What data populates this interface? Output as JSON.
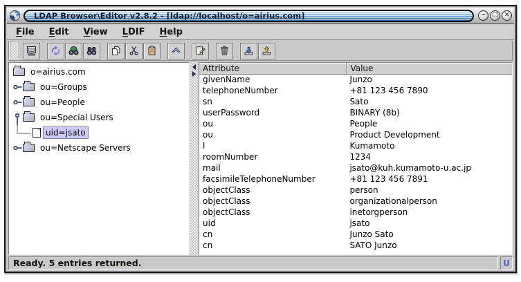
{
  "window": {
    "title": "LDAP Browser\\Editor v2.8.2 - [ldap://localhost/o=airius.com]",
    "app_icon": "globe-swirl-icon",
    "controls": [
      {
        "name": "minimize",
        "glyph": "−"
      },
      {
        "name": "maximize",
        "glyph": "□"
      },
      {
        "name": "close",
        "glyph": "✕"
      }
    ]
  },
  "menu_bar": {
    "items": [
      {
        "label": "File",
        "mnemonic": "F"
      },
      {
        "label": "Edit",
        "mnemonic": "E"
      },
      {
        "label": "View",
        "mnemonic": "V"
      },
      {
        "label": "LDIF",
        "mnemonic": "L"
      },
      {
        "label": "Help",
        "mnemonic": "H"
      }
    ]
  },
  "toolbar": {
    "buttons": [
      {
        "name": "connect",
        "icon": "computer-icon",
        "group": 0
      },
      {
        "name": "refresh",
        "icon": "refresh-icon",
        "group": 1
      },
      {
        "name": "search",
        "icon": "binoculars-green-icon",
        "group": 1
      },
      {
        "name": "find",
        "icon": "binoculars-icon",
        "group": 1
      },
      {
        "name": "copy",
        "icon": "copy-icon",
        "group": 2
      },
      {
        "name": "cut",
        "icon": "scissors-icon",
        "group": 2
      },
      {
        "name": "paste",
        "icon": "clipboard-icon",
        "group": 2
      },
      {
        "name": "parent-entry",
        "icon": "chevron-up-icon",
        "group": 3
      },
      {
        "name": "edit-entry",
        "icon": "edit-page-icon",
        "group": 4
      },
      {
        "name": "delete-entry",
        "icon": "trash-icon",
        "group": 5
      },
      {
        "name": "import-ldif",
        "icon": "import-arrow-icon",
        "group": 6
      },
      {
        "name": "export-ldif",
        "icon": "export-arrow-icon",
        "group": 6
      }
    ]
  },
  "tree": {
    "nodes": [
      {
        "label": "o=airius.com",
        "icon": "folder",
        "expander": "none",
        "level": 0,
        "selected": false
      },
      {
        "label": "ou=Groups",
        "icon": "folder",
        "expander": "collapsed",
        "level": 1,
        "selected": false
      },
      {
        "label": "ou=People",
        "icon": "folder",
        "expander": "collapsed",
        "level": 1,
        "selected": false
      },
      {
        "label": "ou=Special Users",
        "icon": "folder",
        "expander": "expanded",
        "level": 1,
        "selected": false
      },
      {
        "label": "uid=jsato",
        "icon": "document",
        "expander": "elbow",
        "level": 2,
        "selected": true
      },
      {
        "label": "ou=Netscape Servers",
        "icon": "folder",
        "expander": "collapsed",
        "level": 1,
        "selected": false
      }
    ]
  },
  "table": {
    "columns": [
      "Attribute",
      "Value"
    ],
    "rows": [
      [
        "givenName",
        "Junzo"
      ],
      [
        "telephoneNumber",
        "+81 123 456 7890"
      ],
      [
        "sn",
        "Sato"
      ],
      [
        "userPassword",
        "BINARY (8b)"
      ],
      [
        "ou",
        "People"
      ],
      [
        "ou",
        "Product Development"
      ],
      [
        "l",
        "Kumamoto"
      ],
      [
        "roomNumber",
        "1234"
      ],
      [
        "mail",
        "jsato@kuh.kumamoto-u.ac.jp"
      ],
      [
        "facsimileTelephoneNumber",
        "+81 123 456 7891"
      ],
      [
        "objectClass",
        "person"
      ],
      [
        "objectClass",
        "organizationalperson"
      ],
      [
        "objectClass",
        "inetorgperson"
      ],
      [
        "uid",
        "jsato"
      ],
      [
        "cn",
        "Junzo Sato"
      ],
      [
        "cn",
        "SATO Junzo"
      ]
    ]
  },
  "status_bar": {
    "message": "Ready. 5 entries returned.",
    "indicator": "U"
  },
  "colors": {
    "selection_bg": "#ccccff",
    "titlebar_pill_top": "#d9ecfb",
    "titlebar_pill_bottom": "#3a6b99",
    "panel_gray": "#c9c9c9",
    "indicator_blue": "#4a5fd0"
  }
}
